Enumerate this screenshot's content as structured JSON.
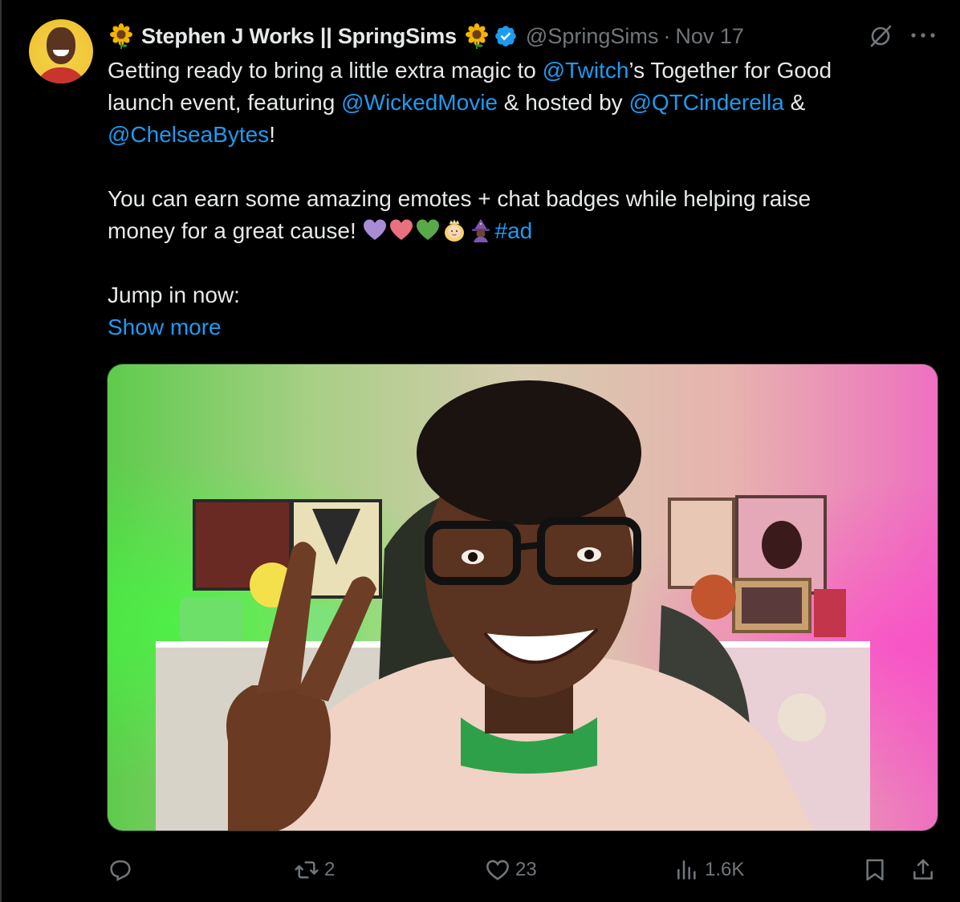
{
  "tweet": {
    "author": {
      "display_name": "Stephen J Works || SpringSims",
      "handle": "@SpringSims",
      "date": "Nov 17",
      "verified": true
    },
    "body": {
      "line1_pre": "Getting ready to bring a little extra magic to ",
      "mention_twitch": "@Twitch",
      "line1_post": "’s Together for Good",
      "line2_pre": "launch event, featuring ",
      "mention_wicked": "@WickedMovie",
      "line2_mid": " & hosted by ",
      "mention_qt": "@QTCinderella",
      "line2_post": " &",
      "mention_chelsea": "@ChelseaBytes",
      "line3_post": "!",
      "para2_line1": "You can earn some amazing emotes + chat badges while helping raise",
      "para2_line2": "money for a great cause! ",
      "hashtag": "#ad",
      "para3": "Jump in now:",
      "show_more": "Show more"
    },
    "emojis": [
      "purple-heart",
      "pink-heart",
      "green-heart",
      "princess",
      "witch"
    ],
    "media": {
      "type": "photo"
    },
    "actions": {
      "reply_count": "",
      "retweet_count": "2",
      "like_count": "23",
      "views_count": "1.6K"
    },
    "colors": {
      "background": "#000000",
      "text": "#e7e9ea",
      "secondary": "#71767b",
      "link": "#1d9bf0",
      "verified": "#1d9bf0"
    }
  }
}
